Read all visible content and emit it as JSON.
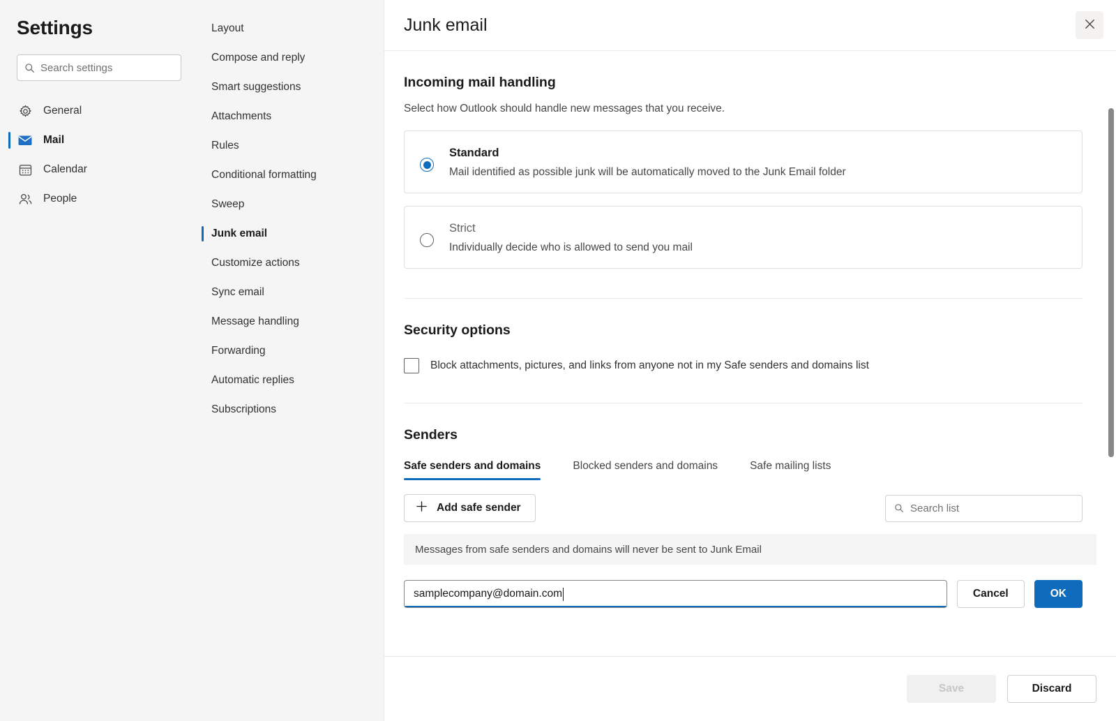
{
  "sidebar": {
    "title": "Settings",
    "search": {
      "placeholder": "Search settings",
      "value": ""
    },
    "items": [
      {
        "label": "General",
        "icon": "gear-icon",
        "active": false
      },
      {
        "label": "Mail",
        "icon": "mail-icon",
        "active": true
      },
      {
        "label": "Calendar",
        "icon": "calendar-icon",
        "active": false
      },
      {
        "label": "People",
        "icon": "people-icon",
        "active": false
      }
    ]
  },
  "subnav": {
    "items": [
      {
        "label": "Layout",
        "active": false
      },
      {
        "label": "Compose and reply",
        "active": false
      },
      {
        "label": "Smart suggestions",
        "active": false
      },
      {
        "label": "Attachments",
        "active": false
      },
      {
        "label": "Rules",
        "active": false
      },
      {
        "label": "Conditional formatting",
        "active": false
      },
      {
        "label": "Sweep",
        "active": false
      },
      {
        "label": "Junk email",
        "active": true
      },
      {
        "label": "Customize actions",
        "active": false
      },
      {
        "label": "Sync email",
        "active": false
      },
      {
        "label": "Message handling",
        "active": false
      },
      {
        "label": "Forwarding",
        "active": false
      },
      {
        "label": "Automatic replies",
        "active": false
      },
      {
        "label": "Subscriptions",
        "active": false
      }
    ]
  },
  "panel": {
    "title": "Junk email",
    "close_label": "Close"
  },
  "incoming": {
    "heading": "Incoming mail handling",
    "description": "Select how Outlook should handle new messages that you receive.",
    "options": [
      {
        "name": "Standard",
        "description": "Mail identified as possible junk will be automatically moved to the Junk Email folder",
        "selected": true
      },
      {
        "name": "Strict",
        "description": "Individually decide who is allowed to send you mail",
        "selected": false
      }
    ]
  },
  "security": {
    "heading": "Security options",
    "checkbox_label": "Block attachments, pictures, and links from anyone not in my Safe senders and domains list",
    "checked": false
  },
  "senders": {
    "heading": "Senders",
    "tabs": [
      {
        "label": "Safe senders and domains",
        "active": true
      },
      {
        "label": "Blocked senders and domains",
        "active": false
      },
      {
        "label": "Safe mailing lists",
        "active": false
      }
    ],
    "add_button": "Add safe sender",
    "list_search_placeholder": "Search list",
    "info_text": "Messages from safe senders and domains will never be sent to Junk Email",
    "edit_value": "samplecompany@domain.com",
    "cancel_label": "Cancel",
    "ok_label": "OK"
  },
  "footer": {
    "save_label": "Save",
    "save_disabled": true,
    "discard_label": "Discard"
  },
  "colors": {
    "accent": "#0f6cbd",
    "panel_bg": "#ffffff",
    "nav_bg": "#f5f5f5",
    "info_bg": "#f5f5f5",
    "border": "#e1dfdd"
  }
}
